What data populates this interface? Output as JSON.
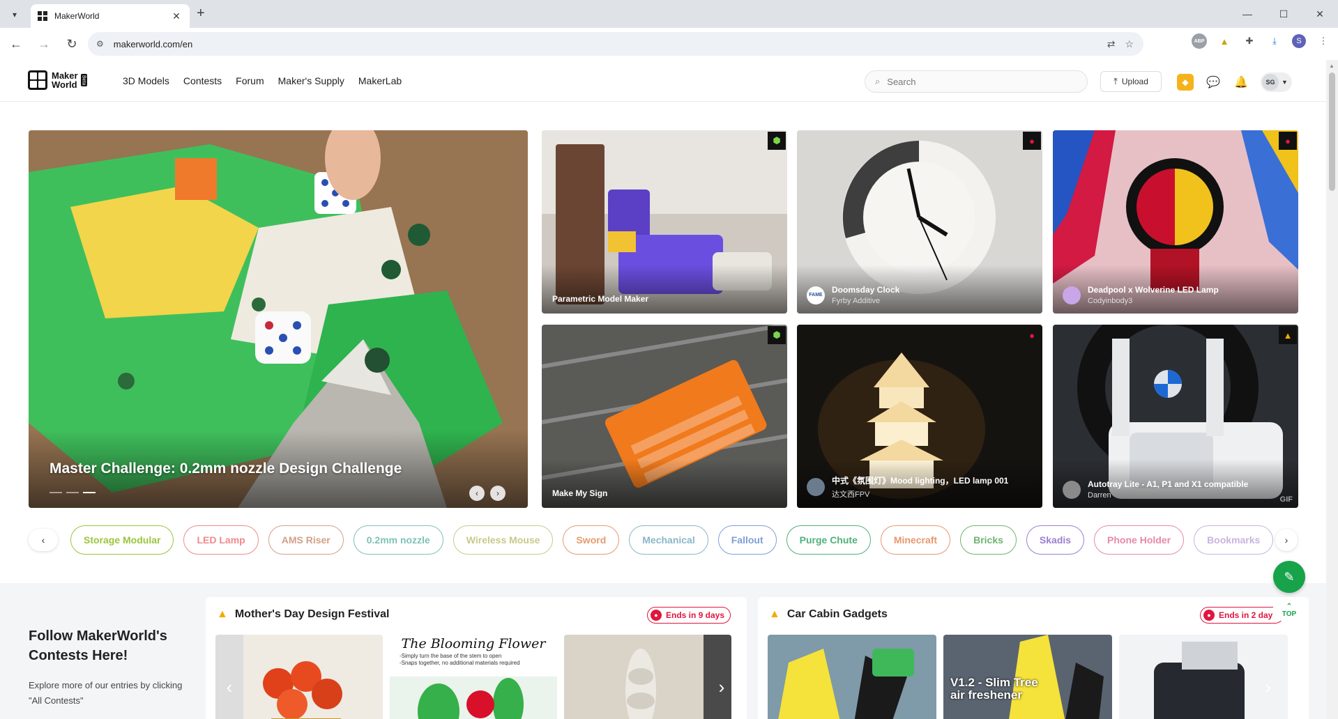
{
  "browser": {
    "tab_title": "MakerWorld",
    "url": "makerworld.com/en",
    "profile_initial": "S"
  },
  "site": {
    "logo_line1": "Maker",
    "logo_line2": "World",
    "logo_beta": "Beta",
    "nav": [
      "3D Models",
      "Contests",
      "Forum",
      "Maker's Supply",
      "MakerLab"
    ],
    "search_placeholder": "Search",
    "upload_label": "Upload",
    "avatar_initials": "SG"
  },
  "hero": {
    "title": "Master Challenge: 0.2mm nozzle Design Challenge",
    "slides": 3,
    "active_slide": 3
  },
  "cards": [
    {
      "title": "Parametric Model Maker",
      "author": "",
      "badge": "makerlab-icon"
    },
    {
      "title": "Doomsday Clock",
      "author": "Fyrby Additive",
      "badge": "hot-icon"
    },
    {
      "title": "Deadpool x Wolverine LED Lamp",
      "author": "Codyinbody3",
      "badge": "hot-icon"
    },
    {
      "title": "Make My Sign",
      "author": "",
      "badge": "makerlab-icon"
    },
    {
      "title": "中式《氛围灯》Mood lighting，LED lamp 001",
      "author": "达文西FPV",
      "badge": "hot-icon"
    },
    {
      "title": "Autotray Lite - A1, P1 and X1 compatible",
      "author": "Darren",
      "badge": "contest-icon",
      "gif": "GIF"
    }
  ],
  "tags": [
    {
      "label": "Storage Modular",
      "color": "#9bc53d"
    },
    {
      "label": "LED Lamp",
      "color": "#f08a8a"
    },
    {
      "label": "AMS Riser",
      "color": "#d2a089"
    },
    {
      "label": "0.2mm nozzle",
      "color": "#7fc1b8"
    },
    {
      "label": "Wireless Mouse",
      "color": "#c9c98a"
    },
    {
      "label": "Sword",
      "color": "#e69a6e"
    },
    {
      "label": "Mechanical",
      "color": "#8ab6c8"
    },
    {
      "label": "Fallout",
      "color": "#7e9ed6"
    },
    {
      "label": "Purge Chute",
      "color": "#4fb07a"
    },
    {
      "label": "Minecraft",
      "color": "#e8976e"
    },
    {
      "label": "Bricks",
      "color": "#6fb36f"
    },
    {
      "label": "Skadis",
      "color": "#9b7fd0"
    },
    {
      "label": "Phone Holder",
      "color": "#e58aa5"
    },
    {
      "label": "Bookmarks",
      "color": "#c9b4e0"
    }
  ],
  "lower": {
    "follow_title": "Follow MakerWorld's Contests Here!",
    "follow_text": "Explore more of our entries by clicking \"All Contests\"",
    "contests": [
      {
        "title": "Mother's Day Design Festival",
        "ends": "Ends in 9 days",
        "thumb_text": "The Blooming Flower",
        "thumb_sub1": "-Simply turn the base of the stem to open",
        "thumb_sub2": "-Snaps together, no additional materials required"
      },
      {
        "title": "Car Cabin Gadgets",
        "ends": "Ends in 2 days",
        "thumb_text": "V1.2 - Slim Tree air freshener"
      }
    ]
  },
  "fab": {
    "top_label": "TOP"
  }
}
